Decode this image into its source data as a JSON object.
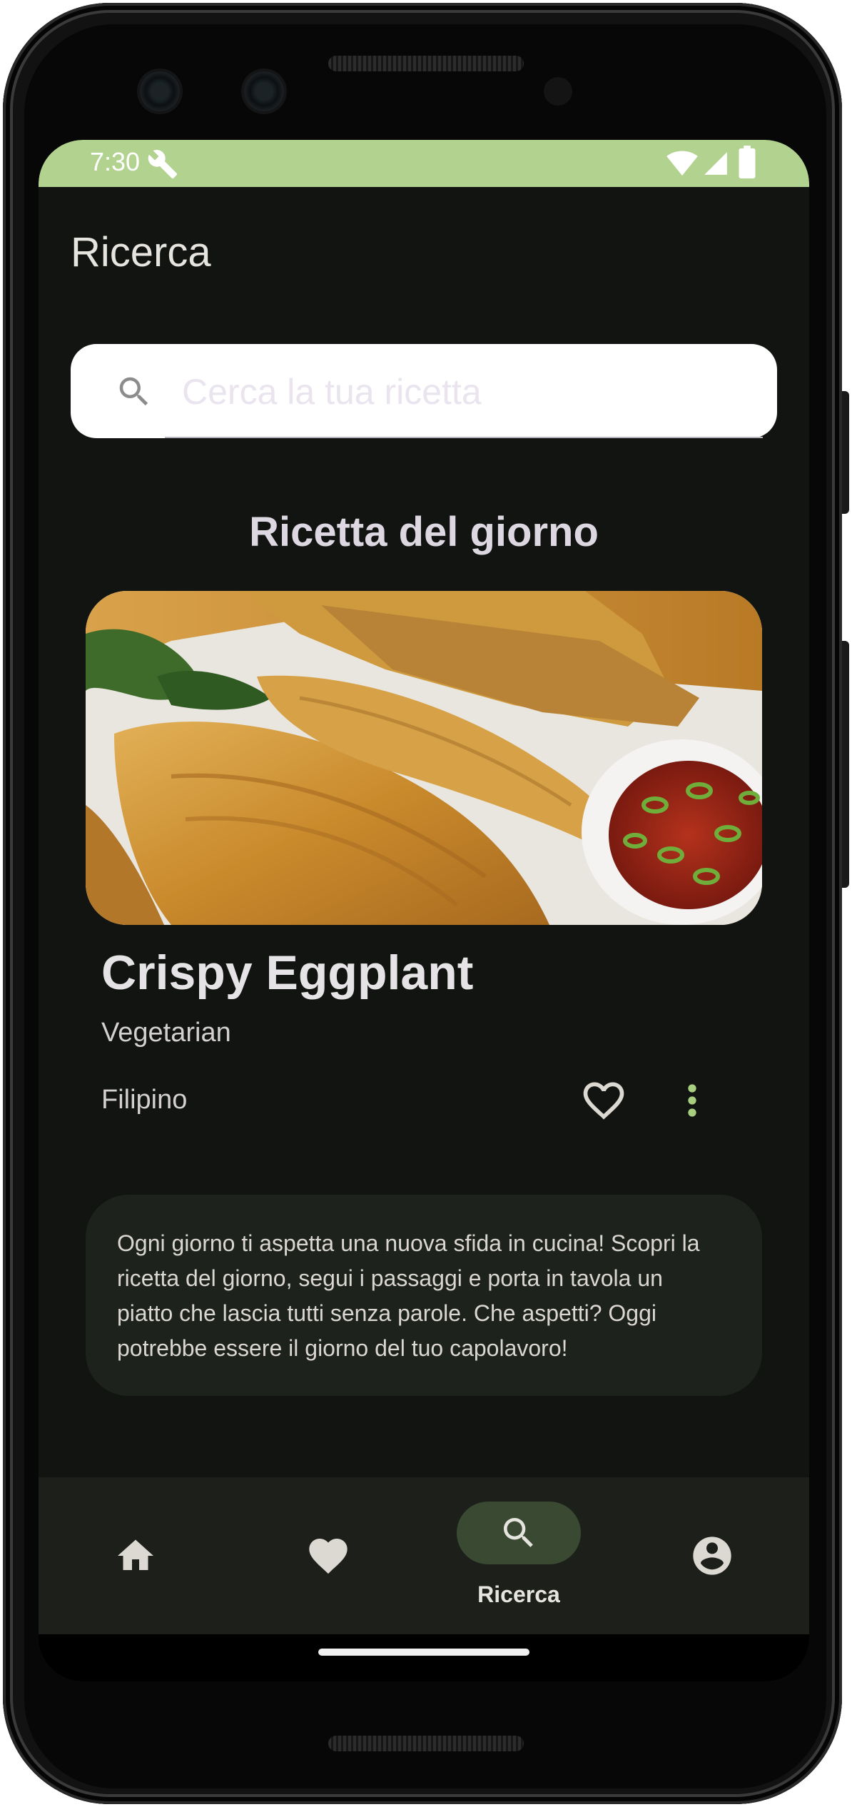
{
  "status_bar": {
    "time": "7:30",
    "icons": [
      "wrench-icon",
      "wifi-icon",
      "cellular-signal-icon",
      "battery-icon"
    ],
    "color": "#b2d28f"
  },
  "header": {
    "title": "Ricerca"
  },
  "search": {
    "placeholder": "Cerca la tua ricetta",
    "value": "",
    "icon": "search-icon"
  },
  "recipe_of_the_day": {
    "section_title": "Ricetta del giorno",
    "name": "Crispy Eggplant",
    "category": "Vegetarian",
    "area": "Filipino",
    "favorite_icon": "heart-outline-icon",
    "more_icon": "more-vert-icon"
  },
  "info_card": {
    "text": "Ogni giorno ti aspetta una nuova sfida in cucina! Scopri la ricetta del giorno, segui i passaggi e porta in tavola un piatto che lascia tutti senza parole. Che aspetti? Oggi potrebbe essere il giorno del tuo capolavoro!"
  },
  "bottom_nav": {
    "items": [
      {
        "icon": "home-icon",
        "label": "",
        "selected": false
      },
      {
        "icon": "heart-icon",
        "label": "",
        "selected": false
      },
      {
        "icon": "search-icon",
        "label": "Ricerca",
        "selected": true
      },
      {
        "icon": "account-circle-icon",
        "label": "",
        "selected": false
      }
    ]
  },
  "colors": {
    "background": "#111410",
    "accent": "#b2d28f",
    "card": "#1e221c",
    "nav_selected": "#3a4a32"
  }
}
